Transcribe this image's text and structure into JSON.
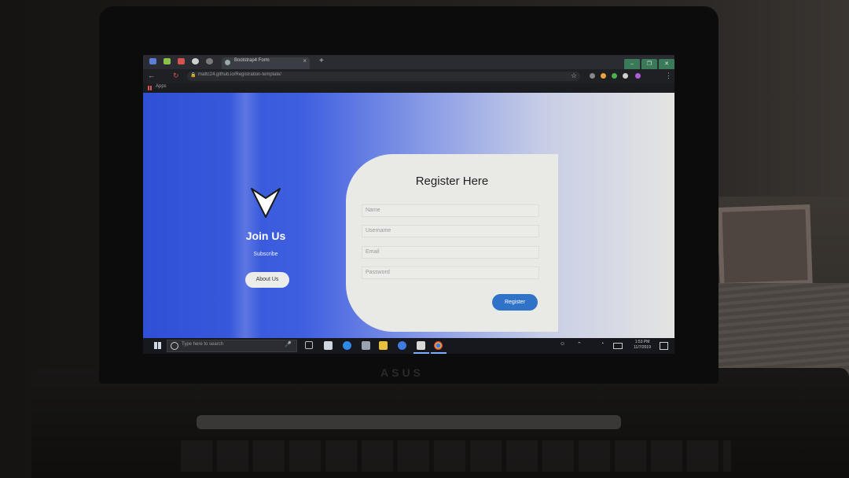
{
  "browser": {
    "tab_title": "Bootstrap4 Form",
    "tab_close": "×",
    "new_tab": "+",
    "url": "mattc24.github.io/Registration-template/",
    "bookmarks_label": "Apps",
    "window_controls": [
      "–",
      "❐",
      "✕"
    ]
  },
  "page": {
    "left_panel": {
      "title": "Join Us",
      "subtitle": "Subscribe",
      "button_label": "About Us"
    },
    "form": {
      "title": "Register Here",
      "fields": [
        {
          "placeholder": "Name"
        },
        {
          "placeholder": "Username"
        },
        {
          "placeholder": "Email"
        },
        {
          "placeholder": "Password"
        }
      ],
      "submit_label": "Register"
    }
  },
  "taskbar": {
    "search_placeholder": "Type here to search",
    "time": "1:53 PM",
    "date": "11/7/2019"
  },
  "laptop_brand": "ASUS",
  "colors": {
    "page_gradient_start": "#2f4fd6",
    "page_gradient_end": "#e4e4e2",
    "register_button": "#2f73c9",
    "card_background": "#e9e9e6"
  }
}
